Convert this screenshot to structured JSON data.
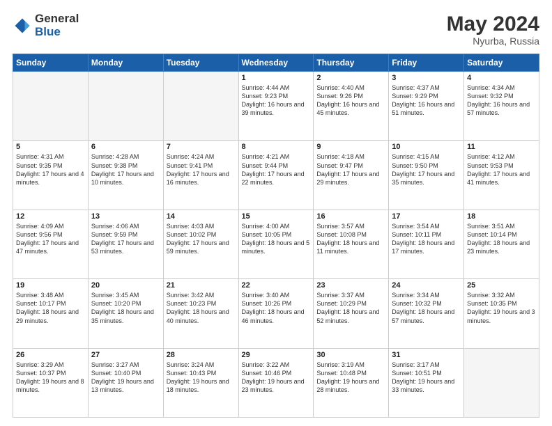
{
  "logo": {
    "general": "General",
    "blue": "Blue",
    "icon": "▶"
  },
  "header": {
    "month_year": "May 2024",
    "location": "Nyurba, Russia"
  },
  "weekdays": [
    "Sunday",
    "Monday",
    "Tuesday",
    "Wednesday",
    "Thursday",
    "Friday",
    "Saturday"
  ],
  "weeks": [
    [
      {
        "day": "",
        "info": ""
      },
      {
        "day": "",
        "info": ""
      },
      {
        "day": "",
        "info": ""
      },
      {
        "day": "1",
        "info": "Sunrise: 4:44 AM\nSunset: 9:23 PM\nDaylight: 16 hours\nand 39 minutes."
      },
      {
        "day": "2",
        "info": "Sunrise: 4:40 AM\nSunset: 9:26 PM\nDaylight: 16 hours\nand 45 minutes."
      },
      {
        "day": "3",
        "info": "Sunrise: 4:37 AM\nSunset: 9:29 PM\nDaylight: 16 hours\nand 51 minutes."
      },
      {
        "day": "4",
        "info": "Sunrise: 4:34 AM\nSunset: 9:32 PM\nDaylight: 16 hours\nand 57 minutes."
      }
    ],
    [
      {
        "day": "5",
        "info": "Sunrise: 4:31 AM\nSunset: 9:35 PM\nDaylight: 17 hours\nand 4 minutes."
      },
      {
        "day": "6",
        "info": "Sunrise: 4:28 AM\nSunset: 9:38 PM\nDaylight: 17 hours\nand 10 minutes."
      },
      {
        "day": "7",
        "info": "Sunrise: 4:24 AM\nSunset: 9:41 PM\nDaylight: 17 hours\nand 16 minutes."
      },
      {
        "day": "8",
        "info": "Sunrise: 4:21 AM\nSunset: 9:44 PM\nDaylight: 17 hours\nand 22 minutes."
      },
      {
        "day": "9",
        "info": "Sunrise: 4:18 AM\nSunset: 9:47 PM\nDaylight: 17 hours\nand 29 minutes."
      },
      {
        "day": "10",
        "info": "Sunrise: 4:15 AM\nSunset: 9:50 PM\nDaylight: 17 hours\nand 35 minutes."
      },
      {
        "day": "11",
        "info": "Sunrise: 4:12 AM\nSunset: 9:53 PM\nDaylight: 17 hours\nand 41 minutes."
      }
    ],
    [
      {
        "day": "12",
        "info": "Sunrise: 4:09 AM\nSunset: 9:56 PM\nDaylight: 17 hours\nand 47 minutes."
      },
      {
        "day": "13",
        "info": "Sunrise: 4:06 AM\nSunset: 9:59 PM\nDaylight: 17 hours\nand 53 minutes."
      },
      {
        "day": "14",
        "info": "Sunrise: 4:03 AM\nSunset: 10:02 PM\nDaylight: 17 hours\nand 59 minutes."
      },
      {
        "day": "15",
        "info": "Sunrise: 4:00 AM\nSunset: 10:05 PM\nDaylight: 18 hours\nand 5 minutes."
      },
      {
        "day": "16",
        "info": "Sunrise: 3:57 AM\nSunset: 10:08 PM\nDaylight: 18 hours\nand 11 minutes."
      },
      {
        "day": "17",
        "info": "Sunrise: 3:54 AM\nSunset: 10:11 PM\nDaylight: 18 hours\nand 17 minutes."
      },
      {
        "day": "18",
        "info": "Sunrise: 3:51 AM\nSunset: 10:14 PM\nDaylight: 18 hours\nand 23 minutes."
      }
    ],
    [
      {
        "day": "19",
        "info": "Sunrise: 3:48 AM\nSunset: 10:17 PM\nDaylight: 18 hours\nand 29 minutes."
      },
      {
        "day": "20",
        "info": "Sunrise: 3:45 AM\nSunset: 10:20 PM\nDaylight: 18 hours\nand 35 minutes."
      },
      {
        "day": "21",
        "info": "Sunrise: 3:42 AM\nSunset: 10:23 PM\nDaylight: 18 hours\nand 40 minutes."
      },
      {
        "day": "22",
        "info": "Sunrise: 3:40 AM\nSunset: 10:26 PM\nDaylight: 18 hours\nand 46 minutes."
      },
      {
        "day": "23",
        "info": "Sunrise: 3:37 AM\nSunset: 10:29 PM\nDaylight: 18 hours\nand 52 minutes."
      },
      {
        "day": "24",
        "info": "Sunrise: 3:34 AM\nSunset: 10:32 PM\nDaylight: 18 hours\nand 57 minutes."
      },
      {
        "day": "25",
        "info": "Sunrise: 3:32 AM\nSunset: 10:35 PM\nDaylight: 19 hours\nand 3 minutes."
      }
    ],
    [
      {
        "day": "26",
        "info": "Sunrise: 3:29 AM\nSunset: 10:37 PM\nDaylight: 19 hours\nand 8 minutes."
      },
      {
        "day": "27",
        "info": "Sunrise: 3:27 AM\nSunset: 10:40 PM\nDaylight: 19 hours\nand 13 minutes."
      },
      {
        "day": "28",
        "info": "Sunrise: 3:24 AM\nSunset: 10:43 PM\nDaylight: 19 hours\nand 18 minutes."
      },
      {
        "day": "29",
        "info": "Sunrise: 3:22 AM\nSunset: 10:46 PM\nDaylight: 19 hours\nand 23 minutes."
      },
      {
        "day": "30",
        "info": "Sunrise: 3:19 AM\nSunset: 10:48 PM\nDaylight: 19 hours\nand 28 minutes."
      },
      {
        "day": "31",
        "info": "Sunrise: 3:17 AM\nSunset: 10:51 PM\nDaylight: 19 hours\nand 33 minutes."
      },
      {
        "day": "",
        "info": ""
      }
    ]
  ]
}
